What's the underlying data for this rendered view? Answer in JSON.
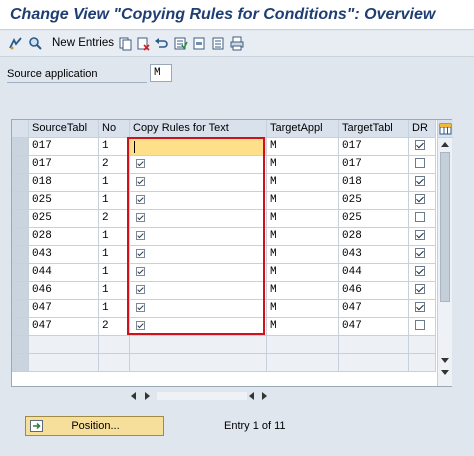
{
  "window": {
    "title": "Change View \"Copying Rules for Conditions\": Overview"
  },
  "toolbar": {
    "new_entries": "New Entries",
    "icons": [
      "display-change-icon",
      "other-view-icon",
      "copy-icon",
      "delete-icon",
      "undo-icon",
      "select-all-icon",
      "select-block-icon",
      "deselect-all-icon",
      "print-icon"
    ]
  },
  "source_app": {
    "label": "Source application",
    "value": "M"
  },
  "table": {
    "columns": [
      "SourceTabl",
      "No",
      "Copy Rules for Text",
      "TargetAppl",
      "TargetTabl",
      "DR"
    ],
    "rows": [
      {
        "src": "017",
        "no": "1",
        "tapp": "M",
        "ttab": "017",
        "dr": true
      },
      {
        "src": "017",
        "no": "2",
        "tapp": "M",
        "ttab": "017",
        "dr": false
      },
      {
        "src": "018",
        "no": "1",
        "tapp": "M",
        "ttab": "018",
        "dr": true
      },
      {
        "src": "025",
        "no": "1",
        "tapp": "M",
        "ttab": "025",
        "dr": true
      },
      {
        "src": "025",
        "no": "2",
        "tapp": "M",
        "ttab": "025",
        "dr": false
      },
      {
        "src": "028",
        "no": "1",
        "tapp": "M",
        "ttab": "028",
        "dr": true
      },
      {
        "src": "043",
        "no": "1",
        "tapp": "M",
        "ttab": "043",
        "dr": true
      },
      {
        "src": "044",
        "no": "1",
        "tapp": "M",
        "ttab": "044",
        "dr": true
      },
      {
        "src": "046",
        "no": "1",
        "tapp": "M",
        "ttab": "046",
        "dr": true
      },
      {
        "src": "047",
        "no": "1",
        "tapp": "M",
        "ttab": "047",
        "dr": true
      },
      {
        "src": "047",
        "no": "2",
        "tapp": "M",
        "ttab": "047",
        "dr": false
      }
    ]
  },
  "footer": {
    "position_button": "Position...",
    "entry_text": "Entry 1 of 11"
  },
  "colors": {
    "title": "#1f3e73",
    "highlight": "#d0101a",
    "button": "#f5df9a",
    "cursor_cell": "#ffe08a"
  }
}
